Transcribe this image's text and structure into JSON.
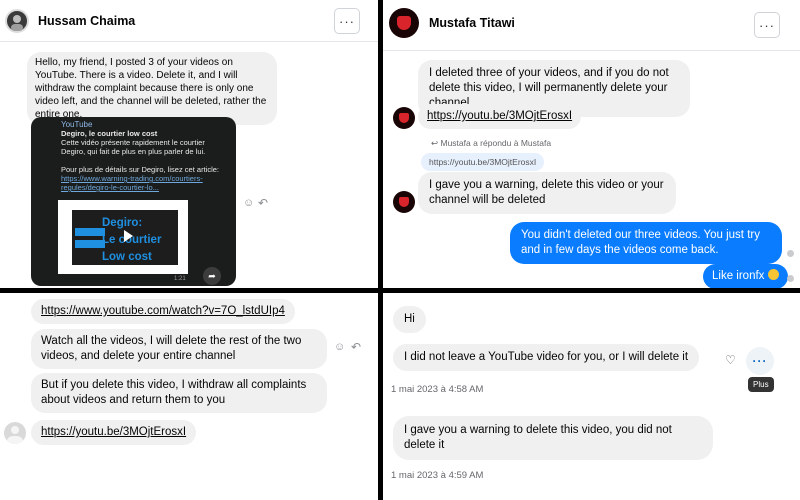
{
  "panel1": {
    "header": {
      "name": "Hussam Chaima",
      "more_label": "···"
    },
    "message": "Hello, my friend, I posted 3 of your videos on YouTube. There is a video. Delete it, and I will withdraw the complaint because there is only one video left, and the channel will be deleted, rather the entire one.",
    "video_card": {
      "channel": "YouTube",
      "title": "Degiro, le courtier low cost",
      "description": "Cette vidéo présente rapidement le courtier Degiro, qui fait de plus en plus parler de lui.",
      "details_prefix": "Pour plus de détails sur Degiro, lisez cet article: ",
      "details_link": "https://www.warning-trading.com/courtiers-regules/degiro-le-courtier-lo...",
      "thumb_line1": "Degiro:",
      "thumb_line2": "Le courtier",
      "thumb_line3": "Low cost",
      "duration": "1:21"
    },
    "react_icon": "smiley-face-icon",
    "reply_icon": "reply-arrow-icon"
  },
  "panel2": {
    "header": {
      "name": "Mustafa Titawi",
      "more_label": "···"
    },
    "msg1": "I deleted three of your videos, and if you do not delete this video, I will permanently delete your channel",
    "link1": "https://youtu.be/3MOjtErosxI",
    "reply_note": "Mustafa a répondu à Mustafa",
    "quoted_link": "https://youtu.be/3MOjtErosxI",
    "msg2": "I gave you a warning, delete this video or your channel will be deleted",
    "blue1": "You didn't deleted our three videos. You just try and in few days the videos come back.",
    "blue2": "Like ironfx"
  },
  "panel3": {
    "link_top": "https://www.youtube.com/watch?v=7O_lstdUIp4",
    "msg1": "Watch all the videos, I will delete the rest of the two videos, and delete your entire channel",
    "msg2": "But if you delete this video, I withdraw all complaints about videos and return them to you",
    "link_bottom": "https://youtu.be/3MOjtErosxI"
  },
  "panel4": {
    "hi": "Hi",
    "msg1": "I did not leave a YouTube video for you, or I will delete it",
    "ts1": "1 mai 2023 à 4:58 AM",
    "tooltip": "Plus",
    "more_label": "···",
    "msg2": "I gave you a warning to delete this video, you did not delete it",
    "ts2": "1 mai 2023 à 4:59 AM"
  },
  "colors": {
    "messenger_blue": "#0a7cff",
    "bubble_grey": "#f0f0f0",
    "quoted_blue": "#e7f0fd"
  }
}
